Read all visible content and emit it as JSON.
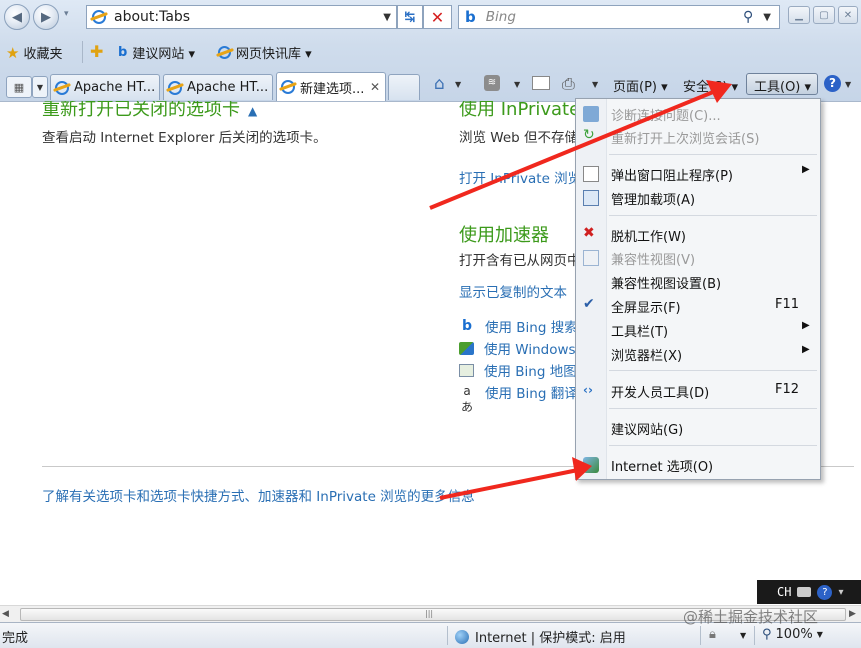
{
  "address_bar": {
    "url": "about:Tabs"
  },
  "search_box": {
    "placeholder": "Bing"
  },
  "favorites_bar": {
    "favorites_label": "收藏夹",
    "suggested_sites": "建议网站 ▾",
    "web_slice_gallery": "网页快讯库 ▾"
  },
  "tabs": [
    {
      "title": "Apache HT..."
    },
    {
      "title": "Apache HT..."
    },
    {
      "title": "新建选项..."
    }
  ],
  "command_bar": {
    "page": "页面(P) ▾",
    "safety": "安全(S) ▾",
    "tools": "工具(O) ▾"
  },
  "content": {
    "reopen_heading": "重新打开已关闭的选项卡",
    "reopen_desc": "查看启动 Internet Explorer 后关闭的选项卡。",
    "inprivate_heading": "使用 InPrivate",
    "inprivate_desc": "浏览 Web 但不存储",
    "inprivate_link": "打开 InPrivate 浏览",
    "accelerator_heading": "使用加速器",
    "accelerator_desc": "打开含有已从网页中",
    "accelerator_copied_link": "显示已复制的文本",
    "accelerators": [
      {
        "label": "使用 Bing 搜索",
        "icon": "bing-icon"
      },
      {
        "label": "使用 Windows",
        "icon": "windows-live-icon"
      },
      {
        "label": "使用 Bing 地图",
        "icon": "map-icon"
      },
      {
        "label": "使用 Bing 翻译",
        "icon": "translate-icon"
      }
    ],
    "learn_more_link": "了解有关选项卡和选项卡快捷方式、加速器和 InPrivate 浏览的更多信息"
  },
  "tools_menu": {
    "items": [
      {
        "label": "诊断连接问题(C)...",
        "disabled": true,
        "icon": "diagnose-icon"
      },
      {
        "label": "重新打开上次浏览会话(S)",
        "disabled": true,
        "icon": "reopen-session-icon"
      },
      {
        "label": "弹出窗口阻止程序(P)",
        "submenu": true,
        "icon": "popup-blocker-icon"
      },
      {
        "label": "管理加载项(A)",
        "icon": "addons-icon"
      },
      {
        "label": "脱机工作(W)",
        "icon": "offline-icon"
      },
      {
        "label": "兼容性视图(V)",
        "disabled": true,
        "icon": "compat-view-icon"
      },
      {
        "label": "兼容性视图设置(B)"
      },
      {
        "label": "全屏显示(F)",
        "shortcut": "F11",
        "checked": true
      },
      {
        "label": "工具栏(T)",
        "submenu": true
      },
      {
        "label": "浏览器栏(X)",
        "submenu": true
      },
      {
        "label": "开发人员工具(D)",
        "shortcut": "F12",
        "icon": "devtools-icon"
      },
      {
        "label": "建议网站(G)"
      },
      {
        "label": "Internet 选项(O)",
        "icon": "internet-options-icon"
      }
    ]
  },
  "status_bar": {
    "status": "完成",
    "zone": "Internet | 保护模式: 启用",
    "zoom": "100%"
  },
  "language_bar": {
    "lang": "CH"
  },
  "watermark": "@稀土掘金技术社区",
  "colors": {
    "annotation_arrow": "#f0281e",
    "heading_green": "#3c9a1b",
    "link_blue": "#2a6fb4"
  }
}
